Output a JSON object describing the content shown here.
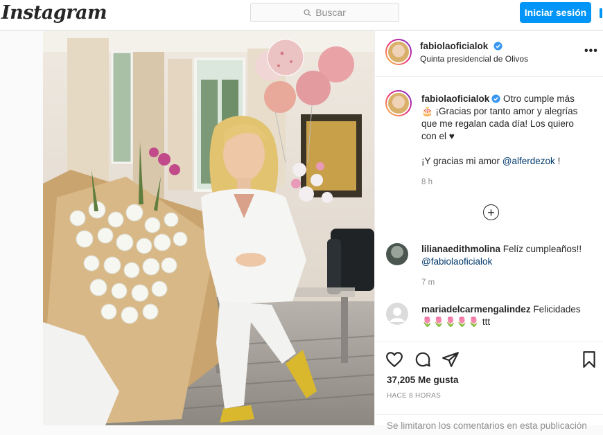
{
  "header": {
    "logo_text": "Instagram",
    "search_placeholder": "Buscar",
    "login_label": "Iniciar sesión"
  },
  "post": {
    "username": "fabiolaoficialok",
    "location": "Quinta presidencial de Olivos",
    "caption_lines": [
      "Otro cumple más",
      "🎂 ¡Gracias por tanto amor y alegrías",
      "que me regalan cada día! Los quiero",
      "con el ♥"
    ],
    "caption_second": "¡Y gracias mi amor",
    "caption_mention": "@alferdezok",
    "caption_end": "!",
    "caption_time": "8 h",
    "likes": "37,205 Me gusta",
    "posted_ago": "HACE 8 HORAS",
    "comments_limited": "Se limitaron los comentarios en esta publicación"
  },
  "comments": [
    {
      "username": "lilianaedithmolina",
      "text": "Felíz cumpleaños!!",
      "mention": "@fabiolaoficialok",
      "time": "7 m"
    },
    {
      "username": "mariadelcarmengalindez",
      "text": "Felicidades",
      "emojis": "🌷🌷🌷🌷🌷",
      "suffix": "ttt"
    }
  ],
  "icons": {
    "search": "search-icon",
    "verified": "verified-badge-icon",
    "more": "more-options-icon",
    "load_more": "plus-circle-icon",
    "like": "heart-icon",
    "comment": "comment-bubble-icon",
    "share": "paper-plane-icon",
    "save": "bookmark-icon",
    "next": "chevron-right-icon"
  },
  "colors": {
    "accent": "#0095f6",
    "mention": "#00376b",
    "muted": "#8e8e8e",
    "verified": "#3897f0"
  }
}
